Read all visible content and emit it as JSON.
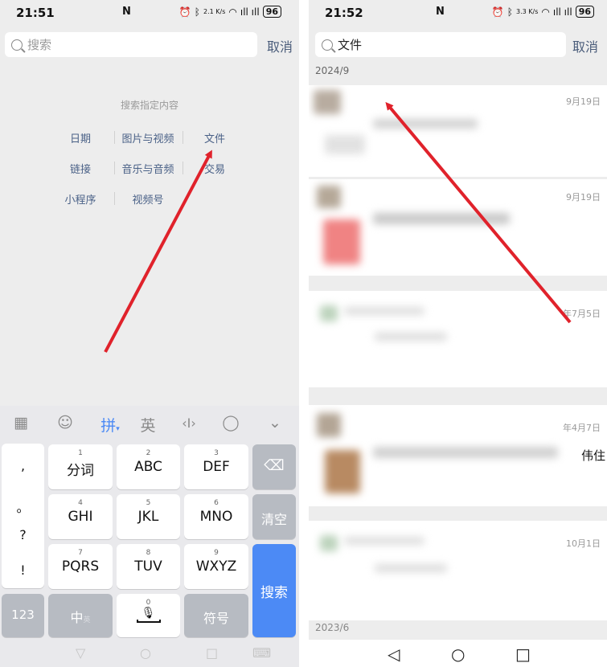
{
  "left": {
    "status": {
      "time": "21:51",
      "nfc": "N",
      "speed": "2.1 K/s",
      "battery": "96"
    },
    "search": {
      "placeholder": "搜索",
      "cancel": "取消"
    },
    "hint": "搜索指定内容",
    "filters": [
      "日期",
      "图片与视频",
      "文件",
      "链接",
      "音乐与音频",
      "交易",
      "小程序",
      "视频号"
    ],
    "keyboard": {
      "toolbar": {
        "mode": "拼",
        "english": "英"
      },
      "punct": [
        ",",
        "。",
        "?",
        "!"
      ],
      "keys": [
        {
          "num": "1",
          "label": "分词"
        },
        {
          "num": "2",
          "label": "ABC"
        },
        {
          "num": "3",
          "label": "DEF"
        },
        {
          "num": "4",
          "label": "GHI"
        },
        {
          "num": "5",
          "label": "JKL"
        },
        {
          "num": "6",
          "label": "MNO"
        },
        {
          "num": "7",
          "label": "PQRS"
        },
        {
          "num": "8",
          "label": "TUV"
        },
        {
          "num": "9",
          "label": "WXYZ"
        }
      ],
      "clear": "清空",
      "search": "搜索",
      "num_mode": "123",
      "chinese": "中",
      "chinese_sub": "英",
      "space_num": "0",
      "symbols": "符号"
    }
  },
  "right": {
    "status": {
      "time": "21:52",
      "nfc": "N",
      "speed": "3.3 K/s",
      "battery": "96"
    },
    "search": {
      "value": "文件",
      "cancel": "取消"
    },
    "section_top": "2024/9",
    "section_bottom": "2023/6",
    "dates": [
      "9月19日",
      "9月19日",
      "年7月5日",
      "年4月7日",
      "10月1日"
    ],
    "partial_text": "伟住"
  },
  "colors": {
    "arrow": "#e0222b",
    "accent": "#4c8af5",
    "link": "#4a6187"
  }
}
